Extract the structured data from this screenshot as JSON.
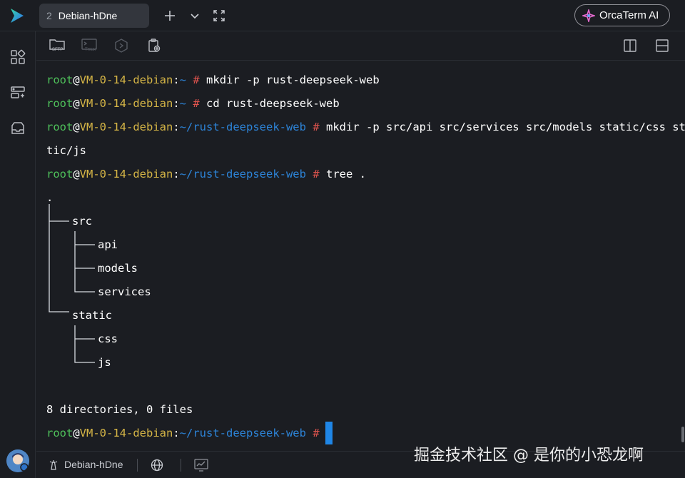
{
  "tab": {
    "number": "2",
    "title": "Debian-hDne"
  },
  "ai_button": {
    "label": "OrcaTerm AI"
  },
  "toolbar": {
    "sftp_label": "SFTP",
    "tmux_label": "Tmux"
  },
  "terminal": {
    "prompt_user": "root",
    "prompt_at": "@",
    "prompt_host": "VM-0-14-debian",
    "prompt_colon": ":",
    "lines": [
      {
        "path": "~",
        "cmd": "mkdir -p rust-deepseek-web"
      },
      {
        "path": "~",
        "cmd": "cd rust-deepseek-web"
      },
      {
        "path": "~/rust-deepseek-web",
        "cmd": "mkdir -p src/api src/services src/models static/css sta"
      },
      {
        "path": "~/rust-deepseek-web",
        "cmd": "tree ."
      }
    ],
    "wrap_line": "tic/js",
    "final_path": "~/rust-deepseek-web",
    "hash": "#",
    "tree_root": ".",
    "tree": [
      {
        "label": "src"
      },
      {
        "label": "api"
      },
      {
        "label": "models"
      },
      {
        "label": "services"
      },
      {
        "label": "static"
      },
      {
        "label": "css"
      },
      {
        "label": "js"
      }
    ],
    "summary": "8 directories, 0 files"
  },
  "statusbar": {
    "host": "Debian-hDne"
  },
  "watermark": "掘金技术社区 @ 是你的小恐龙啊",
  "colors": {
    "user": "#4fc25b",
    "host": "#d5b546",
    "path": "#2d84d8",
    "hash": "#e0544e",
    "cursor": "#1f86e6"
  }
}
